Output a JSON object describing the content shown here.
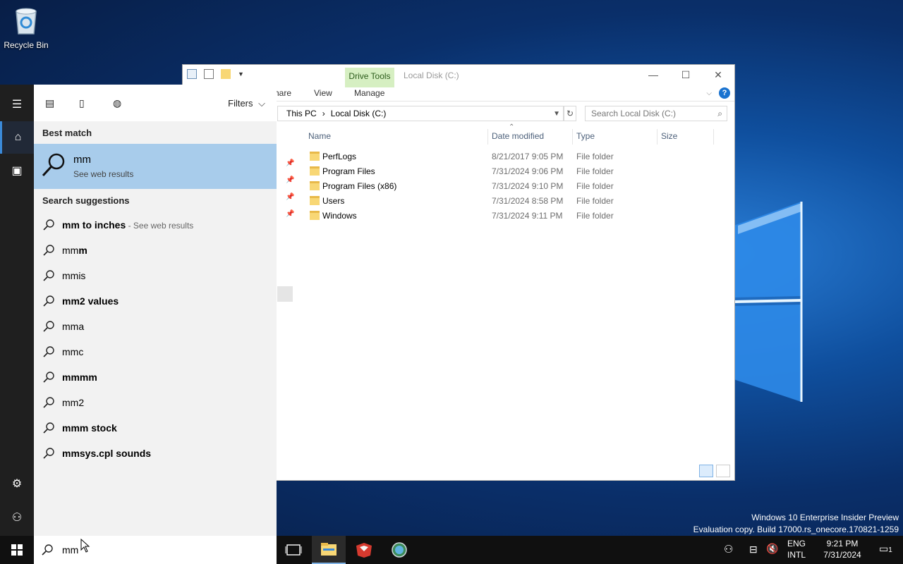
{
  "desktop": {
    "recycle_bin_label": "Recycle Bin",
    "watermark_line1": "Windows 10 Enterprise Insider Preview",
    "watermark_line2": "Evaluation copy. Build 17000.rs_onecore.170821-1259"
  },
  "explorer": {
    "title": "Local Disk (C:)",
    "contextual_tab": "Drive Tools",
    "tabs": [
      "hare",
      "View",
      "Manage"
    ],
    "breadcrumb": [
      "This PC",
      "Local Disk (C:)"
    ],
    "search_placeholder": "Search Local Disk (C:)",
    "columns": [
      "Name",
      "Date modified",
      "Type",
      "Size"
    ],
    "files": [
      {
        "name": "PerfLogs",
        "date": "8/21/2017 9:05 PM",
        "type": "File folder"
      },
      {
        "name": "Program Files",
        "date": "7/31/2024 9:06 PM",
        "type": "File folder"
      },
      {
        "name": "Program Files (x86)",
        "date": "7/31/2024 9:10 PM",
        "type": "File folder"
      },
      {
        "name": "Users",
        "date": "7/31/2024 8:58 PM",
        "type": "File folder"
      },
      {
        "name": "Windows",
        "date": "7/31/2024 9:11 PM",
        "type": "File folder"
      }
    ]
  },
  "search_panel": {
    "filters_label": "Filters",
    "best_match_heading": "Best match",
    "best_match_title": "mm",
    "best_match_subtitle": "See web results",
    "suggestions_heading": "Search suggestions",
    "suggestions": [
      {
        "text": "mm to inches",
        "hint": " - See web results"
      },
      {
        "text": "mmm",
        "hint": ""
      },
      {
        "text": "mmis",
        "hint": ""
      },
      {
        "text": "mm2 values",
        "hint": ""
      },
      {
        "text": "mma",
        "hint": ""
      },
      {
        "text": "mmc",
        "hint": ""
      },
      {
        "text": "mmmm",
        "hint": ""
      },
      {
        "text": "mm2",
        "hint": ""
      },
      {
        "text": "mmm stock",
        "hint": ""
      },
      {
        "text": "mmsys.cpl sounds",
        "hint": ""
      }
    ],
    "query": "mm"
  },
  "taskbar": {
    "lang_top": "ENG",
    "lang_bottom": "INTL",
    "time": "9:21 PM",
    "date": "7/31/2024",
    "notification_count": "1"
  },
  "colors": {
    "accent": "#3b8ad9",
    "selection": "#a8cceb",
    "drive_tools": "#d6efc2"
  }
}
